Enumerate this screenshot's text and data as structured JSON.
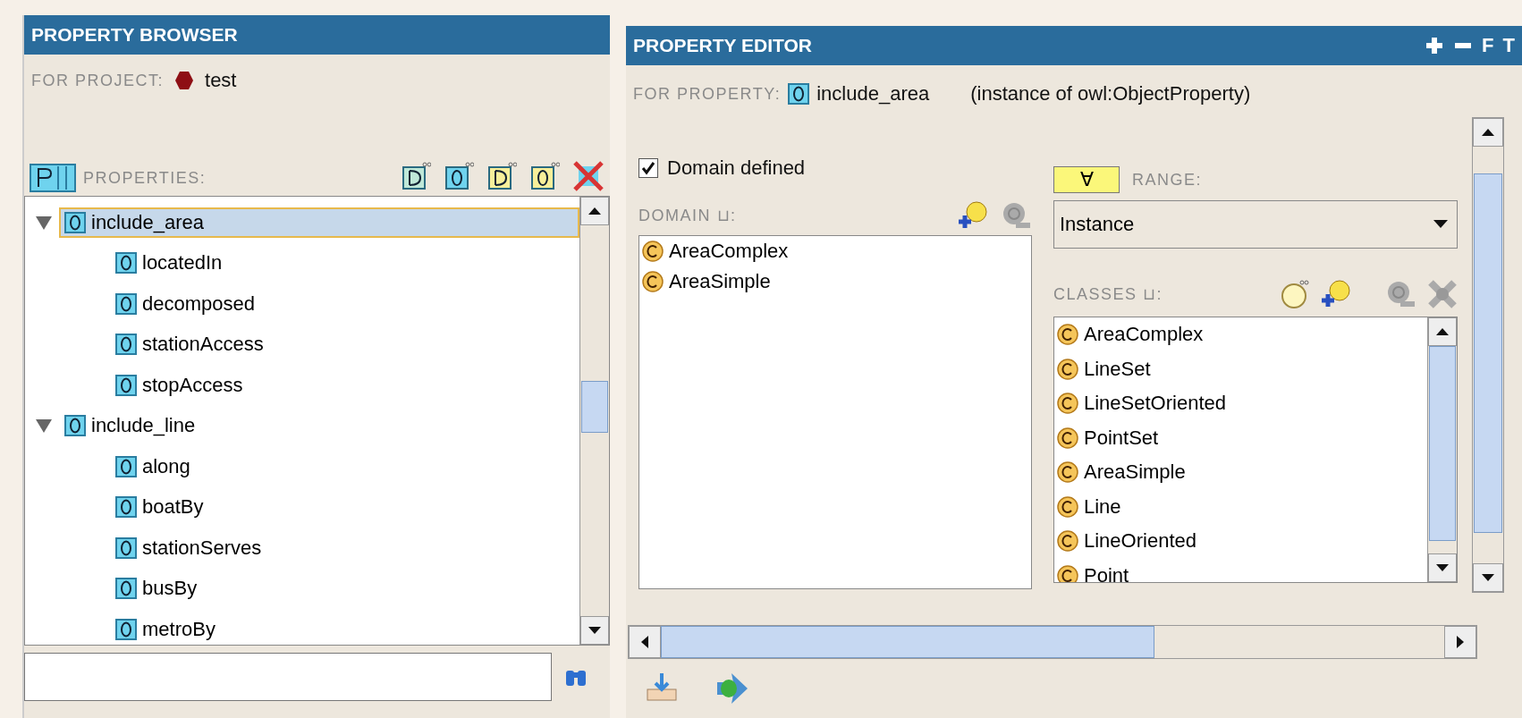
{
  "browser": {
    "title": "PROPERTY BROWSER",
    "project_label": "FOR PROJECT:",
    "project_name": "test",
    "properties_label": "PROPERTIES:",
    "tree": [
      {
        "label": "include_area",
        "selected": true,
        "expanded": true,
        "children": [
          {
            "label": "locatedIn",
            "selected": false
          },
          {
            "label": "decomposed",
            "selected": false
          },
          {
            "label": "stationAccess",
            "selected": false
          },
          {
            "label": "stopAccess",
            "selected": false
          }
        ]
      },
      {
        "label": "include_line",
        "selected": false,
        "expanded": true,
        "children": [
          {
            "label": "along",
            "selected": false
          },
          {
            "label": "boatBy",
            "selected": false
          },
          {
            "label": "stationServes",
            "selected": false
          },
          {
            "label": "busBy",
            "selected": false
          },
          {
            "label": "metroBy",
            "selected": false
          }
        ]
      }
    ]
  },
  "editor": {
    "title": "PROPERTY EDITOR",
    "header_buttons": [
      "F",
      "T"
    ],
    "property_label": "FOR PROPERTY:",
    "property_name": "include_area",
    "property_type": "(instance of owl:ObjectProperty)",
    "domain_defined": {
      "label": "Domain defined",
      "checked": true
    },
    "domain_label": "DOMAIN ⊔:",
    "domain_items": [
      "AreaComplex",
      "AreaSimple"
    ],
    "range_quantifier": "∀",
    "range_label": "RANGE:",
    "range_value": "Instance",
    "classes_label": "CLASSES ⊔:",
    "classes": [
      "AreaComplex",
      "LineSet",
      "LineSetOriented",
      "PointSet",
      "AreaSimple",
      "Line",
      "LineOriented",
      "Point"
    ]
  }
}
